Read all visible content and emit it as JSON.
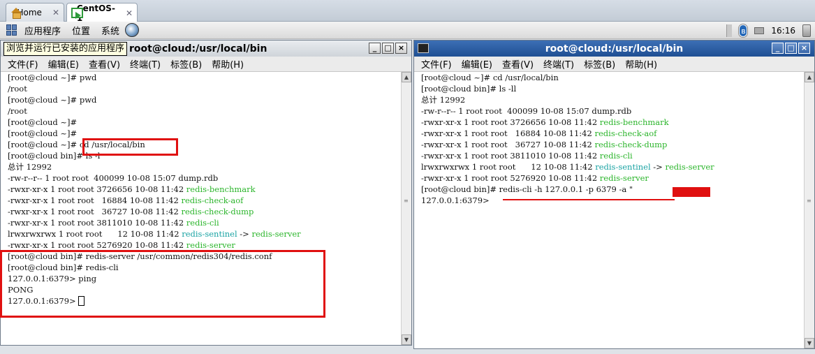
{
  "vm_tabs": [
    {
      "label": "Home",
      "icon": "home-icon"
    },
    {
      "label": "CentOS-1",
      "icon": "vm-icon"
    }
  ],
  "panel": {
    "menus": [
      "应用程序",
      "位置",
      "系统"
    ],
    "clock": "16:16"
  },
  "left_terminal": {
    "title": "root@cloud:/usr/local/bin",
    "tooltip": "浏览并运行已安装的应用程序",
    "menu": [
      "文件(F)",
      "编辑(E)",
      "查看(V)",
      "终端(T)",
      "标签(B)",
      "帮助(H)"
    ],
    "lines": [
      {
        "text": "[root@cloud ~]# pwd"
      },
      {
        "text": "/root"
      },
      {
        "text": "[root@cloud ~]# pwd"
      },
      {
        "text": "/root"
      },
      {
        "text": "[root@cloud ~]#"
      },
      {
        "text": "[root@cloud ~]#"
      },
      {
        "text": "[root@cloud ~]# cd /usr/local/bin"
      },
      {
        "text": "[root@cloud bin]# ls -l"
      },
      {
        "text": "总计 12992"
      },
      {
        "text": "-rw-r--r-- 1 root root  400099 10-08 15:07 dump.rdb"
      },
      {
        "prefix": "-rwxr-xr-x 1 root root 3726656 10-08 11:42 ",
        "name": "redis-benchmark",
        "color": "green"
      },
      {
        "prefix": "-rwxr-xr-x 1 root root   16884 10-08 11:42 ",
        "name": "redis-check-aof",
        "color": "green"
      },
      {
        "prefix": "-rwxr-xr-x 1 root root   36727 10-08 11:42 ",
        "name": "redis-check-dump",
        "color": "green"
      },
      {
        "prefix": "-rwxr-xr-x 1 root root 3811010 10-08 11:42 ",
        "name": "redis-cli",
        "color": "green"
      },
      {
        "prefix": "lrwxrwxrwx 1 root root      12 10-08 11:42 ",
        "name": "redis-sentinel",
        "color": "cyan",
        "suffix": " -> ",
        "target": "redis-server"
      },
      {
        "prefix": "-rwxr-xr-x 1 root root 5276920 10-08 11:42 ",
        "name": "redis-server",
        "color": "green"
      },
      {
        "text": "[root@cloud bin]# redis-server /usr/common/redis304/redis.conf"
      },
      {
        "text": "[root@cloud bin]# redis-cli"
      },
      {
        "text": "127.0.0.1:6379> ping"
      },
      {
        "text": "PONG"
      },
      {
        "text": "127.0.0.1:6379> ",
        "cursor": true
      }
    ]
  },
  "right_terminal": {
    "title": "root@cloud:/usr/local/bin",
    "menu": [
      "文件(F)",
      "编辑(E)",
      "查看(V)",
      "终端(T)",
      "标签(B)",
      "帮助(H)"
    ],
    "lines": [
      {
        "text": "[root@cloud ~]# cd /usr/local/bin"
      },
      {
        "text": "[root@cloud bin]# ls -ll"
      },
      {
        "text": "总计 12992"
      },
      {
        "text": "-rw-r--r-- 1 root root  400099 10-08 15:07 dump.rdb"
      },
      {
        "prefix": "-rwxr-xr-x 1 root root 3726656 10-08 11:42 ",
        "name": "redis-benchmark",
        "color": "green"
      },
      {
        "prefix": "-rwxr-xr-x 1 root root   16884 10-08 11:42 ",
        "name": "redis-check-aof",
        "color": "green"
      },
      {
        "prefix": "-rwxr-xr-x 1 root root   36727 10-08 11:42 ",
        "name": "redis-check-dump",
        "color": "green"
      },
      {
        "prefix": "-rwxr-xr-x 1 root root 3811010 10-08 11:42 ",
        "name": "redis-cli",
        "color": "green"
      },
      {
        "prefix": "lrwxrwxrwx 1 root root      12 10-08 11:42 ",
        "name": "redis-sentinel",
        "color": "cyan",
        "suffix": " -> ",
        "target": "redis-server"
      },
      {
        "prefix": "-rwxr-xr-x 1 root root 5276920 10-08 11:42 ",
        "name": "redis-server",
        "color": "green"
      },
      {
        "text": "[root@cloud bin]# redis-cli -h 127.0.0.1 -p 6379 -a \""
      },
      {
        "text": "127.0.0.1:6379>"
      }
    ]
  },
  "colors": {
    "annotation": "#e01010",
    "ls_executable": "#2bb52b",
    "ls_symlink": "#1aa3a3"
  }
}
